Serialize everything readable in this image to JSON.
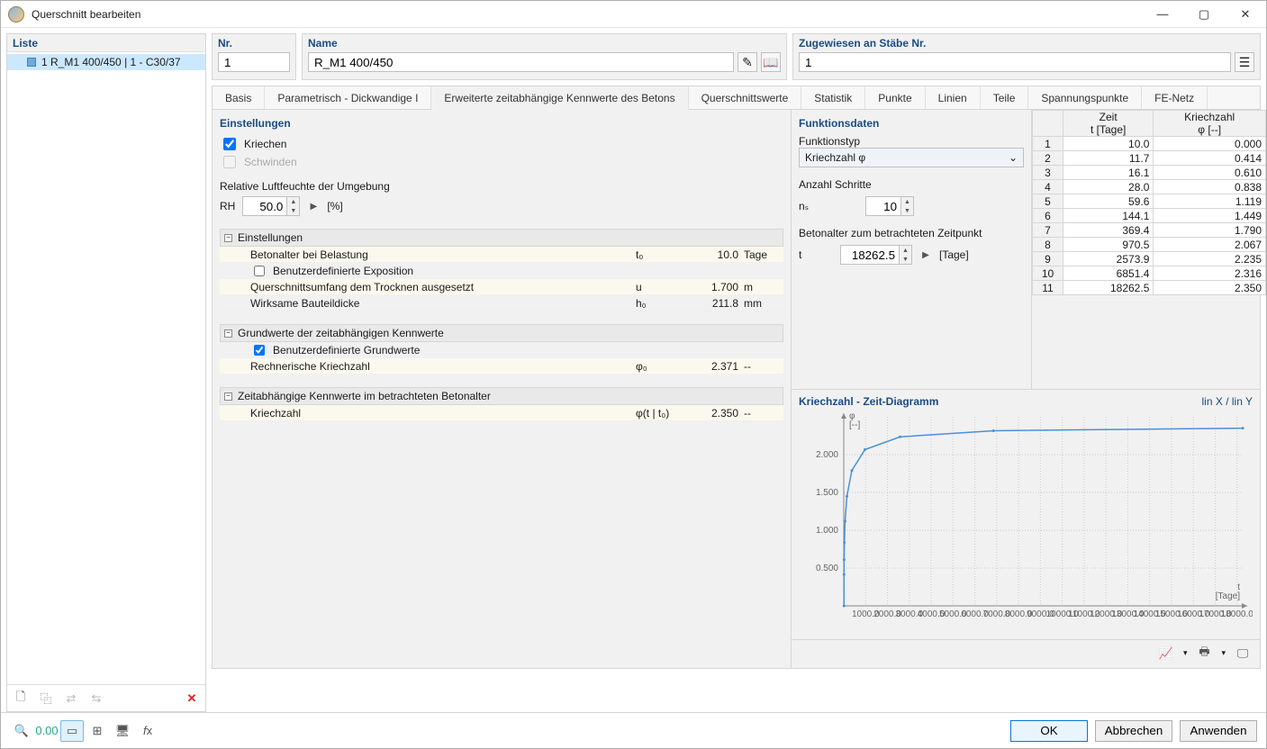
{
  "window_title": "Querschnitt bearbeiten",
  "liste_header": "Liste",
  "list_item": "1   R_M1 400/450 | 1 - C30/37",
  "field_nr": {
    "label": "Nr.",
    "value": "1"
  },
  "field_name": {
    "label": "Name",
    "value": "R_M1 400/450"
  },
  "field_assign": {
    "label": "Zugewiesen an Stäbe Nr.",
    "value": "1"
  },
  "tabs": [
    "Basis",
    "Parametrisch - Dickwandige I",
    "Erweiterte zeitabhängige Kennwerte des Betons",
    "Querschnittswerte",
    "Statistik",
    "Punkte",
    "Linien",
    "Teile",
    "Spannungspunkte",
    "FE-Netz"
  ],
  "active_tab": 2,
  "settings": {
    "title": "Einstellungen",
    "kriechen": "Kriechen",
    "schwinden": "Schwinden",
    "rh_label": "Relative Luftfeuchte der Umgebung",
    "rh_sym": "RH",
    "rh_value": "50.0",
    "rh_unit": "[%]"
  },
  "prop_groups": [
    {
      "name": "Einstellungen",
      "rows": [
        {
          "n": "Betonalter bei Belastung",
          "s": "t₀",
          "v": "10.0",
          "u": "Tage",
          "alt": true
        },
        {
          "n": "Benutzerdefinierte Exposition",
          "chk": true,
          "checked": false
        },
        {
          "n": "Querschnittsumfang dem Trocknen ausgesetzt",
          "s": "u",
          "v": "1.700",
          "u": "m",
          "alt": true
        },
        {
          "n": "Wirksame Bauteildicke",
          "s": "h₀",
          "v": "211.8",
          "u": "mm"
        }
      ]
    },
    {
      "name": "Grundwerte der zeitabhängigen Kennwerte",
      "rows": [
        {
          "n": "Benutzerdefinierte Grundwerte",
          "chk": true,
          "checked": true
        },
        {
          "n": "Rechnerische Kriechzahl",
          "s": "φ₀",
          "v": "2.371",
          "u": "--",
          "alt": true
        }
      ]
    },
    {
      "name": "Zeitabhängige Kennwerte im betrachteten Betonalter",
      "rows": [
        {
          "n": "Kriechzahl",
          "s": "φ(t | t₀)",
          "v": "2.350",
          "u": "--",
          "alt": true
        }
      ]
    }
  ],
  "func": {
    "title": "Funktionsdaten",
    "type_label": "Funktionstyp",
    "type_value": "Kriechzahl φ",
    "steps_label": "Anzahl Schritte",
    "steps_sym": "nₛ",
    "steps_value": "10",
    "age_label": "Betonalter zum betrachteten Zeitpunkt",
    "age_sym": "t",
    "age_value": "18262.5",
    "age_unit": "[Tage]"
  },
  "table": {
    "headers": [
      "",
      "Zeit\nt [Tage]",
      "Kriechzahl\nφ [--]"
    ],
    "rows": [
      [
        "1",
        "10.0",
        "0.000"
      ],
      [
        "2",
        "11.7",
        "0.414"
      ],
      [
        "3",
        "16.1",
        "0.610"
      ],
      [
        "4",
        "28.0",
        "0.838"
      ],
      [
        "5",
        "59.6",
        "1.119"
      ],
      [
        "6",
        "144.1",
        "1.449"
      ],
      [
        "7",
        "369.4",
        "1.790"
      ],
      [
        "8",
        "970.5",
        "2.067"
      ],
      [
        "9",
        "2573.9",
        "2.235"
      ],
      [
        "10",
        "6851.4",
        "2.316"
      ],
      [
        "11",
        "18262.5",
        "2.350"
      ]
    ]
  },
  "chart": {
    "title": "Kriechzahl - Zeit-Diagramm",
    "scale": "lin X / lin Y"
  },
  "chart_data": {
    "type": "line",
    "x": [
      10.0,
      11.7,
      16.1,
      28.0,
      59.6,
      144.1,
      369.4,
      970.5,
      2573.9,
      6851.4,
      18262.5
    ],
    "y": [
      0.0,
      0.414,
      0.61,
      0.838,
      1.119,
      1.449,
      1.79,
      2.067,
      2.235,
      2.316,
      2.35
    ],
    "xlabel": "t [Tage]",
    "ylabel": "φ [--]",
    "xticks": [
      1000,
      2000,
      3000,
      4000,
      5000,
      6000,
      7000,
      8000,
      9000,
      10000,
      11000,
      12000,
      13000,
      14000,
      15000,
      16000,
      17000,
      18000
    ],
    "yticks": [
      0.5,
      1.0,
      1.5,
      2.0
    ],
    "xlim": [
      0,
      18300
    ],
    "ylim": [
      0,
      2.5
    ]
  },
  "buttons": {
    "ok": "OK",
    "cancel": "Abbrechen",
    "apply": "Anwenden"
  }
}
